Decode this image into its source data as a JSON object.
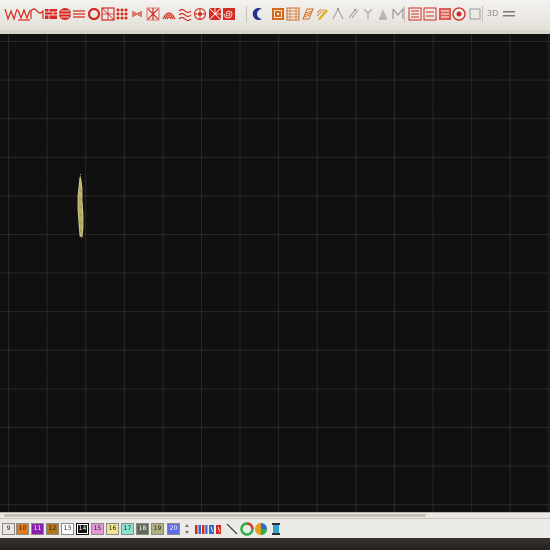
{
  "toolbar": {
    "label_3d": "3D",
    "tools": [
      {
        "icon": "w-fill-icon",
        "color": "#d42b20"
      },
      {
        "icon": "zigzag-fill-icon",
        "color": "#d42b20"
      },
      {
        "icon": "wave-fill-icon",
        "color": "#d42b20"
      },
      {
        "icon": "brick-fill-icon",
        "color": "#d42b20"
      },
      {
        "icon": "scale-fill-icon",
        "color": "#d42b20"
      },
      {
        "icon": "circle-lines-icon",
        "color": "#d42b20"
      },
      {
        "icon": "ring-icon",
        "color": "#d42b20"
      },
      {
        "icon": "checker-icon",
        "color": "#d42b20"
      },
      {
        "icon": "dots-grid-icon",
        "color": "#d42b20"
      },
      {
        "icon": "vertical-marks-icon",
        "color": "#d42b20"
      },
      {
        "icon": "cross-fill-icon",
        "color": "#d42b20"
      },
      {
        "icon": "arc-fill-icon",
        "color": "#d42b20"
      },
      {
        "icon": "wave-lines-icon",
        "color": "#d42b20"
      },
      {
        "icon": "flower-icon",
        "color": "#d42b20"
      },
      {
        "icon": "radial-fill-icon",
        "color": "#d42b20"
      },
      {
        "icon": "spiral-fill-icon",
        "color": "#d42b20"
      },
      {
        "icon": "crescent-icon",
        "color": "#23318f"
      },
      {
        "icon": "contour-fill-icon",
        "color": "#d46a20"
      },
      {
        "icon": "motif-fill-icon",
        "color": "#d46a20"
      },
      {
        "icon": "satin-column-icon",
        "color": "#d46a20"
      },
      {
        "icon": "edit-stitch-icon",
        "color": "#e0b020"
      },
      {
        "icon": "node-edit-icon",
        "color": "#9a9a9a"
      },
      {
        "icon": "split-node-icon",
        "color": "#9a9a9a"
      },
      {
        "icon": "branch-icon",
        "color": "#9a9a9a"
      },
      {
        "icon": "reshape-icon",
        "color": "#9a9a9a"
      },
      {
        "icon": "monogram-icon",
        "color": "#9a9a9a"
      },
      {
        "icon": "stitch-list-icon",
        "color": "#d42b20"
      },
      {
        "icon": "object-list-icon",
        "color": "#d42b20"
      },
      {
        "icon": "layers-icon",
        "color": "#d42b20"
      },
      {
        "icon": "thread-spool-icon",
        "color": "#d42b20"
      },
      {
        "icon": "view-3d-icon",
        "color": "#9a9a9a"
      }
    ]
  },
  "palette": {
    "swatches": [
      {
        "number": "9",
        "color": "#e8e6e0"
      },
      {
        "number": "10",
        "color": "#e07a1a"
      },
      {
        "number": "11",
        "color": "#8a1fb0"
      },
      {
        "number": "12",
        "color": "#b3761a"
      },
      {
        "number": "13",
        "color": "#ffffff"
      },
      {
        "number": "14",
        "color": "#121212"
      },
      {
        "number": "15",
        "color": "#e894d8"
      },
      {
        "number": "16",
        "color": "#f1e28f"
      },
      {
        "number": "17",
        "color": "#8ee3ce"
      },
      {
        "number": "18",
        "color": "#5f6b5a"
      },
      {
        "number": "19",
        "color": "#b0b07e"
      },
      {
        "number": "20",
        "color": "#5f6ee8"
      }
    ],
    "active_number": "14"
  },
  "bottom_tools": [
    {
      "icon": "sequence-bars-icon"
    },
    {
      "icon": "split-block-icon"
    },
    {
      "icon": "line-tool-icon"
    },
    {
      "icon": "color-wheel-icon"
    },
    {
      "icon": "gradient-circle-icon"
    },
    {
      "icon": "spool-icon"
    }
  ],
  "canvas": {
    "background": "#101010",
    "stitch_object": {
      "color": "#c8c27a",
      "kind": "narrow satin column"
    }
  }
}
